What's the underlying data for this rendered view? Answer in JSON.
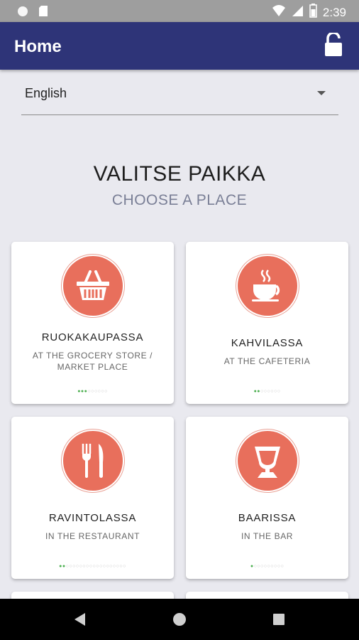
{
  "status_bar": {
    "time": "2:39"
  },
  "app_bar": {
    "title": "Home"
  },
  "language_select": {
    "value": "English"
  },
  "heading": {
    "title": "VALITSE PAIKKA",
    "subtitle": "CHOOSE A PLACE"
  },
  "cards": [
    {
      "name": "RUOKAKAUPASSA",
      "sub": "AT THE GROCERY STORE / MARKET PLACE",
      "icon": "shopping-basket-icon",
      "progress": {
        "filled": 3,
        "total": 9
      }
    },
    {
      "name": "KAHVILASSA",
      "sub": "AT THE CAFETERIA",
      "icon": "coffee-cup-icon",
      "progress": {
        "filled": 2,
        "total": 8
      }
    },
    {
      "name": "RAVINTOLASSA",
      "sub": "IN THE RESTAURANT",
      "icon": "fork-knife-icon",
      "progress": {
        "filled": 2,
        "total": 20
      }
    },
    {
      "name": "BAARISSA",
      "sub": "IN THE BAR",
      "icon": "wine-glass-icon",
      "progress": {
        "filled": 1,
        "total": 10
      }
    }
  ],
  "colors": {
    "app_bar": "#2e3478",
    "icon_circle": "#e86f5c",
    "progress_filled": "#4caf50",
    "background": "#e9e9ef"
  }
}
